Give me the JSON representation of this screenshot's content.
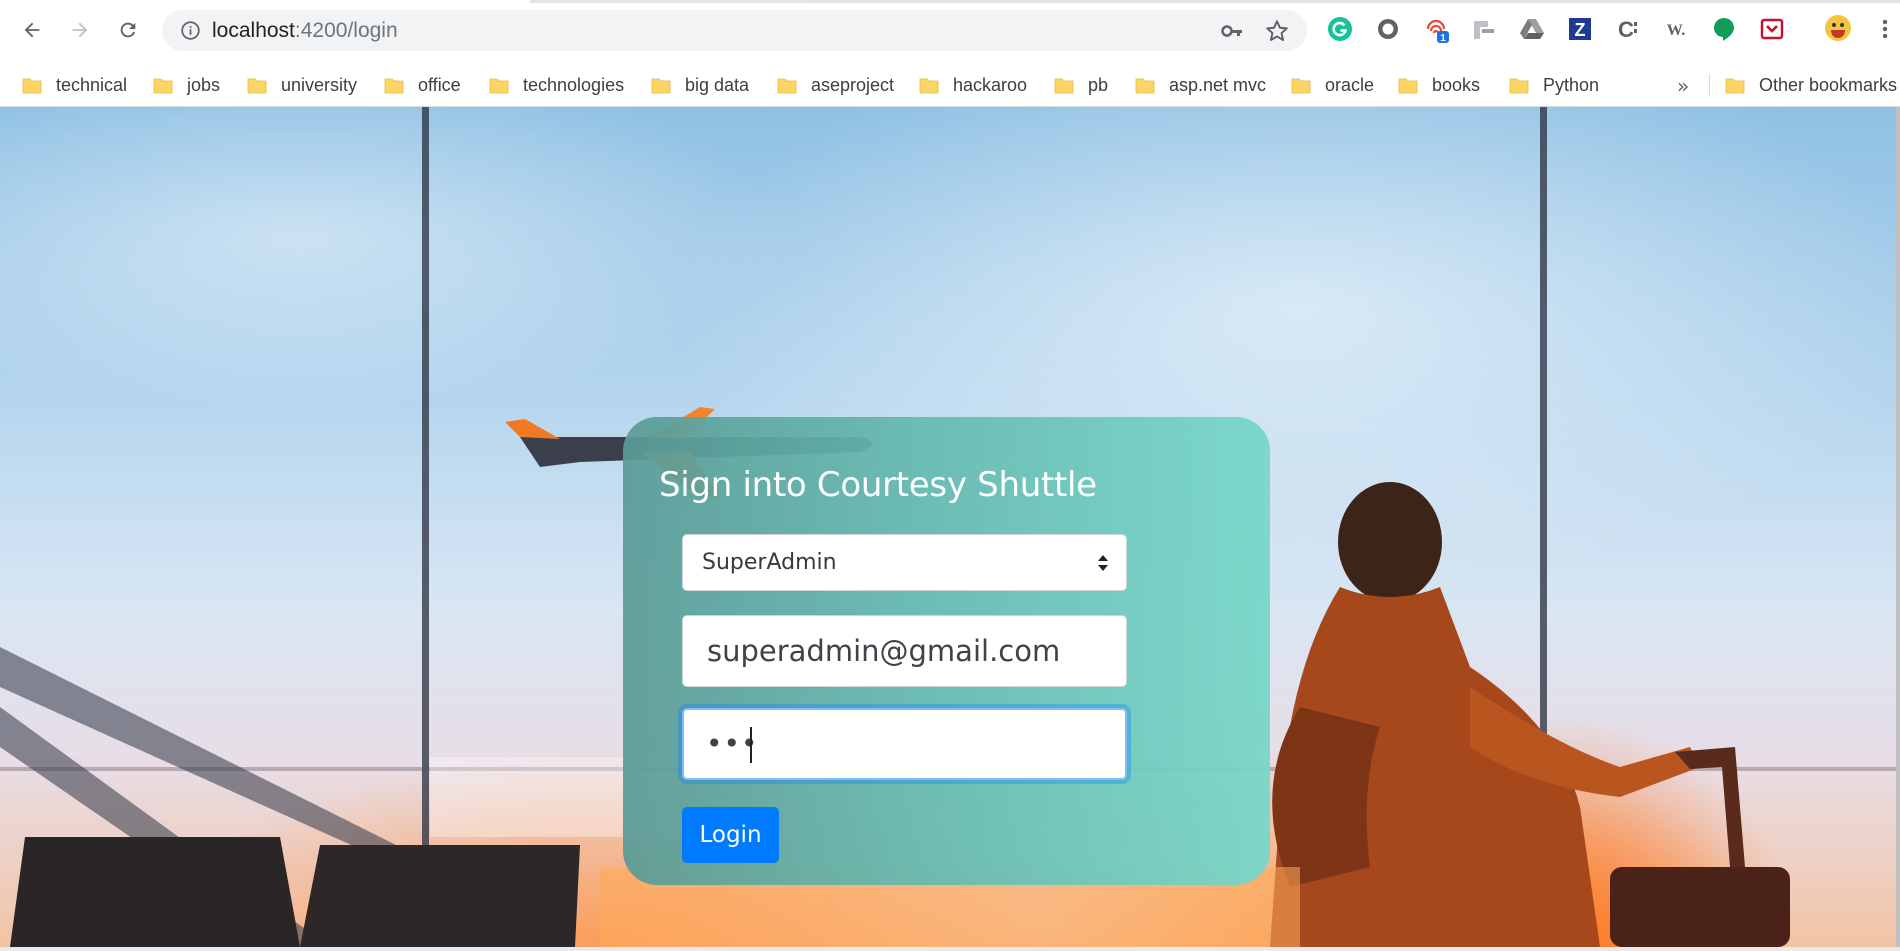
{
  "browser": {
    "url_host": "localhost",
    "url_path": ":4200/login",
    "nav": {
      "back_icon": "back-arrow-icon",
      "forward_icon": "forward-arrow-icon",
      "reload_icon": "reload-icon"
    },
    "extensions": [
      {
        "name": "grammarly-icon",
        "color": "#15c39a"
      },
      {
        "name": "extension-circle-icon",
        "color": "#5f6368"
      },
      {
        "name": "fingerprint-icon",
        "color": "#e8453c",
        "badge": "1"
      },
      {
        "name": "extension-tile-icon",
        "color": "#9aa0a6"
      },
      {
        "name": "drive-icon",
        "color": "#7c7c7c"
      },
      {
        "name": "zotero-icon",
        "color": "#1f3a93",
        "letter": "Z"
      },
      {
        "name": "extension-c-icon",
        "color": "#5f6368",
        "letter": "C"
      },
      {
        "name": "extension-w-icon",
        "color": "#5f6368",
        "letter": "W."
      },
      {
        "name": "hangouts-icon",
        "color": "#0f9d58"
      },
      {
        "name": "pocket-icon",
        "color": "#c8102e"
      },
      {
        "name": "profile-avatar-icon",
        "color": "#f5c542"
      },
      {
        "name": "menu-dots-icon",
        "color": "#5f6368"
      }
    ]
  },
  "bookmarks": {
    "items": [
      "technical",
      "jobs",
      "university",
      "office",
      "technologies",
      "big data",
      "aseproject",
      "hackaroo",
      "pb",
      "asp.net mvc",
      "oracle",
      "books",
      "Python"
    ],
    "more": "»",
    "other": "Other bookmarks"
  },
  "login": {
    "title": "Sign into Courtesy Shuttle",
    "role_selected": "SuperAdmin",
    "email_value": "superadmin@gmail.com",
    "password_value": "•••",
    "button_label": "Login"
  },
  "colors": {
    "primary": "#007bff",
    "card_gradient_start": "#5a9b96",
    "card_gradient_end": "#78d7c8",
    "sunset_orange": "#ff6e14"
  }
}
